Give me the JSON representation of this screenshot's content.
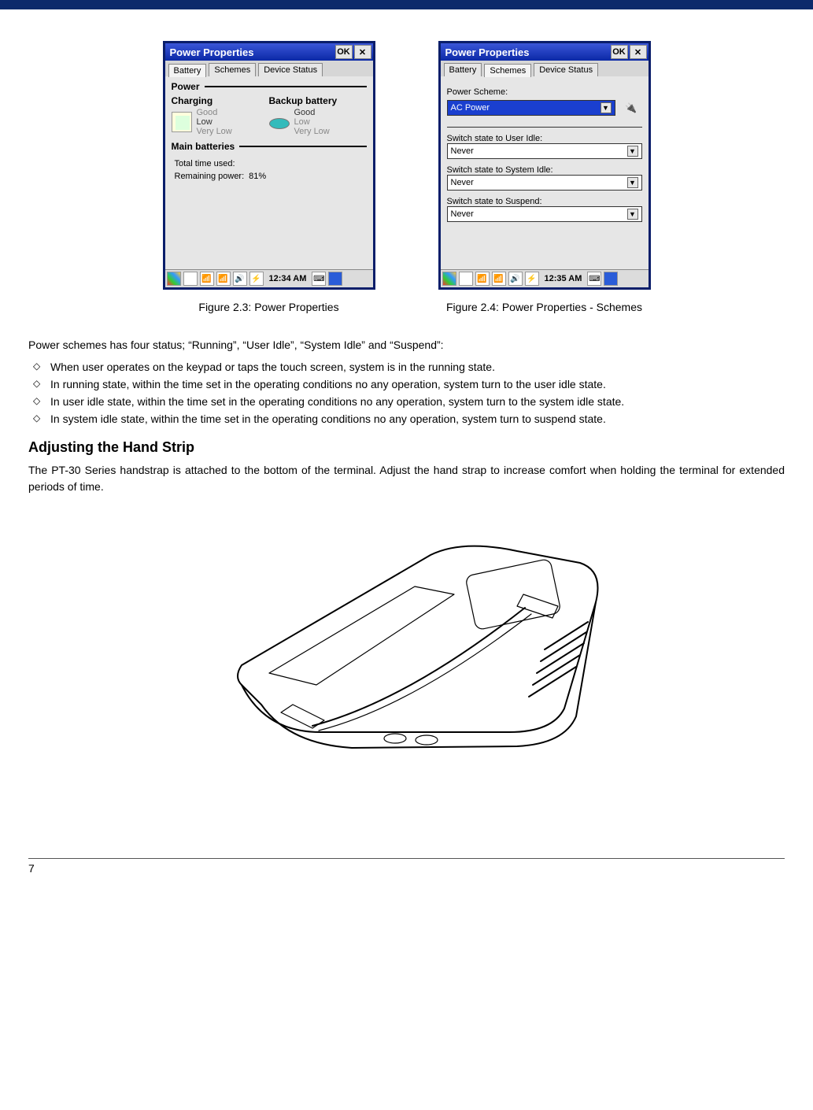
{
  "figLeft": {
    "window_title": "Power Properties",
    "ok": "OK",
    "tabs": {
      "battery": "Battery",
      "schemes": "Schemes",
      "device": "Device Status",
      "active": "battery"
    },
    "group_power": "Power",
    "charging_label": "Charging",
    "backup_label": "Backup battery",
    "levels": {
      "good": "Good",
      "low": "Low",
      "vlow": "Very Low"
    },
    "group_main": "Main batteries",
    "total_time_label": "Total time used:",
    "remaining_label": "Remaining power:",
    "remaining_value": "81%",
    "time": "12:34 AM",
    "caption": "Figure 2.3: Power Properties"
  },
  "figRight": {
    "window_title": "Power Properties",
    "ok": "OK",
    "tabs": {
      "battery": "Battery",
      "schemes": "Schemes",
      "device": "Device Status",
      "active": "schemes"
    },
    "power_scheme_label": "Power Scheme:",
    "power_scheme_value": "AC Power",
    "user_idle_label": "Switch state to User Idle:",
    "user_idle_value": "Never",
    "system_idle_label": "Switch state to System Idle:",
    "system_idle_value": "Never",
    "suspend_label": "Switch state to Suspend:",
    "suspend_value": "Never",
    "time": "12:35 AM",
    "caption": "Figure 2.4: Power Properties - Schemes"
  },
  "text": {
    "statuses_intro": "Power schemes has four status; “Running”, “User Idle”, “System Idle” and “Suspend”:",
    "b1": "When user operates on the keypad or taps the touch screen, system is in the running state.",
    "b2": "In running state, within the time set in the operating conditions no any operation, system turn to the user idle state.",
    "b3": "In user idle state, within the time set in the operating conditions no any operation, system turn to the system idle state.",
    "b4": "In system idle state, within the time set in the operating conditions no any operation, system turn to suspend state.",
    "section_heading": "Adjusting the Hand Strip",
    "strap_para": "The PT-30 Series handstrap is attached to the bottom of the terminal. Adjust the hand strap to increase comfort when holding the terminal for extended periods of time.",
    "page_number": "7"
  }
}
